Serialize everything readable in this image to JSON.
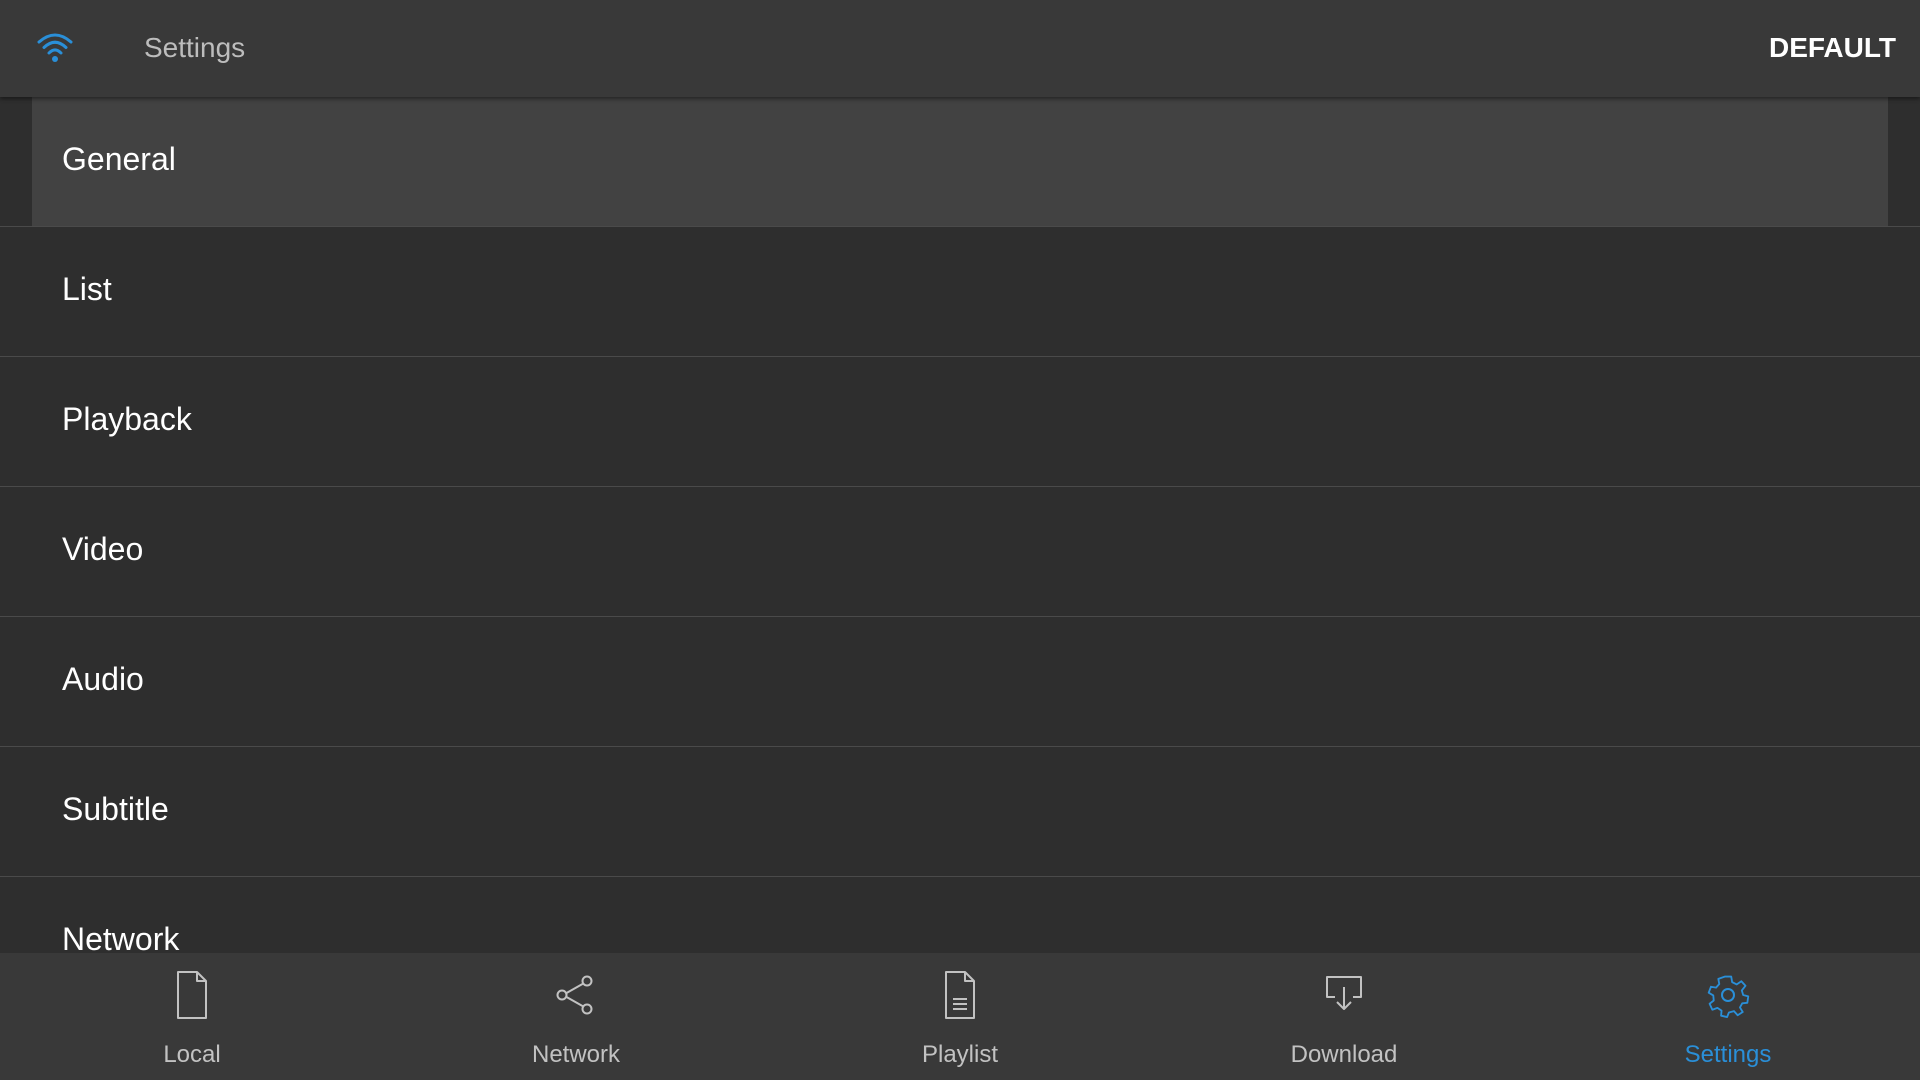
{
  "header": {
    "title": "Settings",
    "default_label": "DEFAULT",
    "icon": "wifi-icon"
  },
  "settings_list": {
    "items": [
      {
        "label": "General",
        "selected": true
      },
      {
        "label": "List"
      },
      {
        "label": "Playback"
      },
      {
        "label": "Video"
      },
      {
        "label": "Audio"
      },
      {
        "label": "Subtitle"
      },
      {
        "label": "Network"
      }
    ]
  },
  "bottom_nav": {
    "items": [
      {
        "label": "Local",
        "icon": "file-icon"
      },
      {
        "label": "Network",
        "icon": "share-icon"
      },
      {
        "label": "Playlist",
        "icon": "document-list-icon"
      },
      {
        "label": "Download",
        "icon": "download-icon"
      },
      {
        "label": "Settings",
        "icon": "gear-icon",
        "active": true
      }
    ]
  },
  "colors": {
    "accent": "#2a8fd8",
    "background": "#2e2e2e",
    "header_bg": "#393939",
    "selected_bg": "#424242",
    "divider": "#4a4a4a"
  }
}
